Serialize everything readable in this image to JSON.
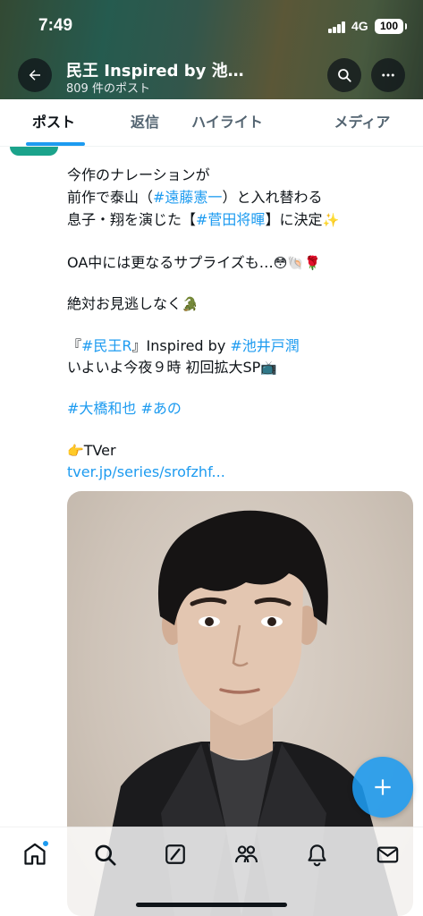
{
  "status_bar": {
    "time": "7:49",
    "network": "4G",
    "battery": "100"
  },
  "header": {
    "account_name": "民王 Inspired by 池…",
    "post_count": "809 件のポスト"
  },
  "tabs": [
    {
      "label": "ポスト",
      "active": true
    },
    {
      "label": "返信",
      "active": false
    },
    {
      "label": "ハイライト",
      "active": false
    },
    {
      "label": "メディア",
      "active": false
    }
  ],
  "post": {
    "line1": "今作のナレーションが",
    "line2_prefix": "前作で泰山（",
    "line2_tag": "#遠藤憲一",
    "line2_suffix": "）と入れ替わる",
    "line3_prefix": "息子・翔を演じた【",
    "line3_tag": "#菅田将暉",
    "line3_suffix": "】に決定",
    "line3_emoji": "✨",
    "line4": "OA中には更なるサプライズも…",
    "line4_emoji": "😳🐚🌹",
    "line5": "絶対お見逃しなく",
    "line5_emoji": "🐊",
    "line6_prefix": "『",
    "line6_tag": "#民王R",
    "line6_middle": "』Inspired by ",
    "line6_tag2": "#池井戸潤",
    "line7": "いよいよ今夜９時 初回拡大SP",
    "line7_emoji": "📺",
    "hashtag1": "#大橋和也",
    "hashtag2": "#あの",
    "tver_emoji": "👉",
    "tver_label": "TVer",
    "tver_link": "tver.jp/series/srofzhf..."
  },
  "icons": {
    "back": "arrow-left-icon",
    "search": "search-icon",
    "more": "more-dots-icon",
    "compose": "plus-icon",
    "nav": [
      "home-icon",
      "explore-search-icon",
      "grok-icon",
      "communities-icon",
      "notifications-bell-icon",
      "messages-envelope-icon"
    ]
  },
  "colors": {
    "accent": "#1d9bf0",
    "text": "#0f1419",
    "muted": "#536471"
  }
}
